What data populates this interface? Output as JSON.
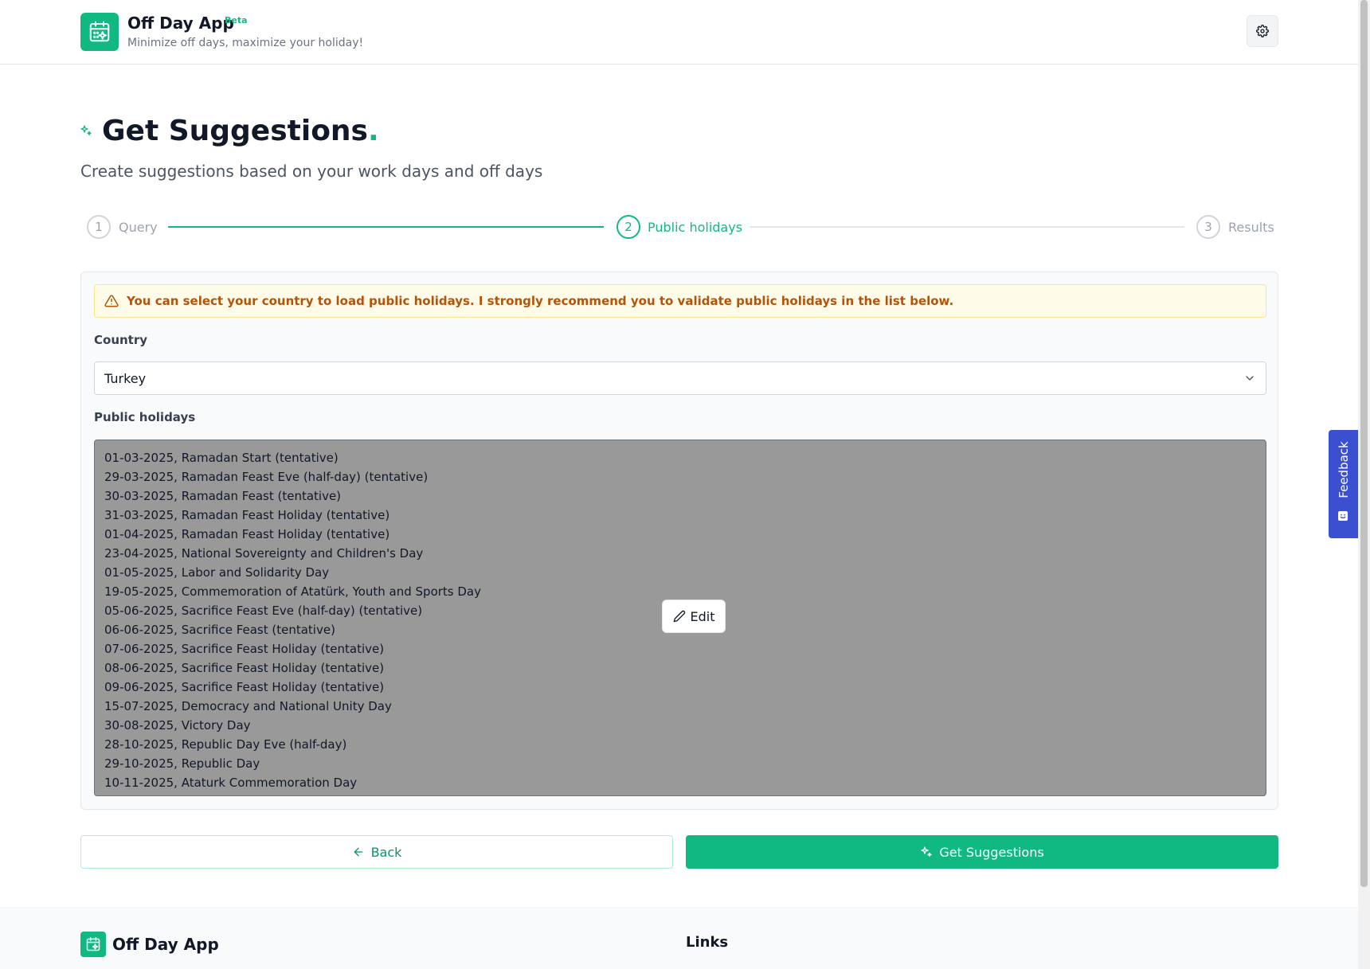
{
  "header": {
    "app_name": "Off Day App",
    "beta_label": "Beta",
    "tagline": "Minimize off days, maximize your holiday!",
    "settings_icon": "gear-icon"
  },
  "page": {
    "title": "Get Suggestions",
    "title_dot": ".",
    "description": "Create suggestions based on your work days and off days"
  },
  "stepper": {
    "steps": [
      {
        "number": "1",
        "label": "Query",
        "state": "completed"
      },
      {
        "number": "2",
        "label": "Public holidays",
        "state": "active"
      },
      {
        "number": "3",
        "label": "Results",
        "state": "upcoming"
      }
    ]
  },
  "form": {
    "alert_text": "You can select your country to load public holidays. I strongly recommend you to validate public holidays in the list below.",
    "country_label": "Country",
    "country_value": "Turkey",
    "holidays_label": "Public holidays",
    "edit_label": "Edit",
    "holidays": [
      "01-03-2025, Ramadan Start (tentative)",
      "29-03-2025, Ramadan Feast Eve (half-day) (tentative)",
      "30-03-2025, Ramadan Feast (tentative)",
      "31-03-2025, Ramadan Feast Holiday (tentative)",
      "01-04-2025, Ramadan Feast Holiday (tentative)",
      "23-04-2025, National Sovereignty and Children's Day",
      "01-05-2025, Labor and Solidarity Day",
      "19-05-2025, Commemoration of Atatürk, Youth and Sports Day",
      "05-06-2025, Sacrifice Feast Eve (half-day) (tentative)",
      "06-06-2025, Sacrifice Feast (tentative)",
      "07-06-2025, Sacrifice Feast Holiday (tentative)",
      "08-06-2025, Sacrifice Feast Holiday (tentative)",
      "09-06-2025, Sacrifice Feast Holiday (tentative)",
      "15-07-2025, Democracy and National Unity Day",
      "30-08-2025, Victory Day",
      "28-10-2025, Republic Day Eve (half-day)",
      "29-10-2025, Republic Day",
      "10-11-2025, Ataturk Commemoration Day"
    ]
  },
  "actions": {
    "back_label": "Back",
    "submit_label": "Get Suggestions"
  },
  "footer": {
    "app_name": "Off Day App",
    "links_heading": "Links"
  },
  "feedback": {
    "label": "Feedback"
  },
  "colors": {
    "accent": "#10b981",
    "warning_text": "#b45309",
    "feedback_bg": "#3b4fd1"
  }
}
